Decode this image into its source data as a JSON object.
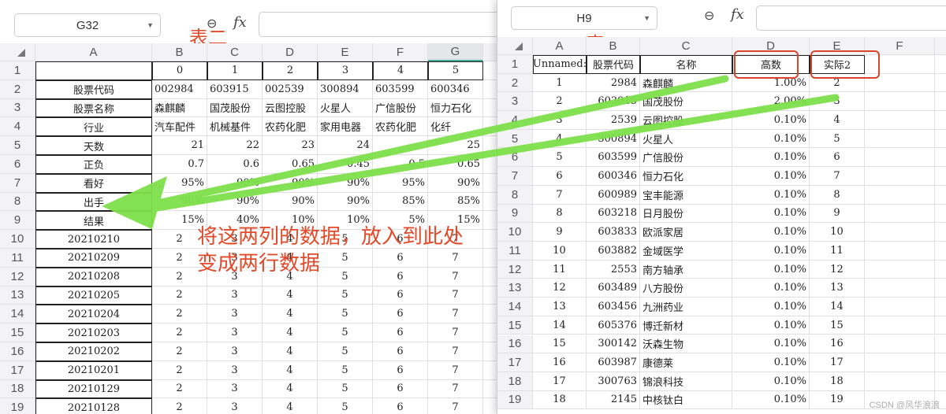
{
  "left": {
    "name_box": "G32",
    "label": "表二",
    "columns": [
      "A",
      "B",
      "C",
      "D",
      "E",
      "F",
      "G"
    ],
    "selected_column": "G",
    "rows": [
      [
        "",
        "0",
        "1",
        "2",
        "3",
        "4",
        "5"
      ],
      [
        "股票代码",
        "002984",
        "603915",
        "002539",
        "300894",
        "603599",
        "600346"
      ],
      [
        "股票名称",
        "森麒麟",
        "国茂股份",
        "云图控股",
        "火星人",
        "广信股份",
        "恒力石化"
      ],
      [
        "行业",
        "汽车配件",
        "机械基件",
        "农药化肥",
        "家用电器",
        "农药化肥",
        "化纤"
      ],
      [
        "天数",
        "21",
        "22",
        "23",
        "24",
        "",
        "25"
      ],
      [
        "正负",
        "0.7",
        "0.6",
        "0.65",
        "0.45",
        "0.5",
        "0.65"
      ],
      [
        "看好",
        "95%",
        "90%",
        "90%",
        "90%",
        "95%",
        "90%"
      ],
      [
        "出手",
        "90%",
        "90%",
        "90%",
        "90%",
        "85%",
        "85%"
      ],
      [
        "结果",
        "15%",
        "40%",
        "10%",
        "10%",
        "5%",
        "15%"
      ],
      [
        "20210210",
        "2",
        "3",
        "4",
        "5",
        "6",
        "7"
      ],
      [
        "20210209",
        "2",
        "3",
        "4",
        "5",
        "6",
        "7"
      ],
      [
        "20210208",
        "2",
        "3",
        "4",
        "5",
        "6",
        "7"
      ],
      [
        "20210205",
        "2",
        "3",
        "4",
        "5",
        "6",
        "7"
      ],
      [
        "20210204",
        "2",
        "3",
        "4",
        "5",
        "6",
        "7"
      ],
      [
        "20210203",
        "2",
        "3",
        "4",
        "5",
        "6",
        "7"
      ],
      [
        "20210202",
        "2",
        "3",
        "4",
        "5",
        "6",
        "7"
      ],
      [
        "20210201",
        "2",
        "3",
        "4",
        "5",
        "6",
        "7"
      ],
      [
        "20210129",
        "2",
        "3",
        "4",
        "5",
        "6",
        "7"
      ],
      [
        "20210128",
        "2",
        "3",
        "4",
        "5",
        "6",
        "7"
      ]
    ]
  },
  "right": {
    "name_box": "H9",
    "label": "表一",
    "columns": [
      "A",
      "B",
      "C",
      "D",
      "E",
      "F"
    ],
    "rows": [
      [
        "Unnamed:",
        "股票代码",
        "名称",
        "高数",
        "实际2",
        ""
      ],
      [
        "1",
        "2984",
        "森麒麟",
        "1.00%",
        "2",
        ""
      ],
      [
        "2",
        "603915",
        "国茂股份",
        "2.00%",
        "3",
        ""
      ],
      [
        "3",
        "2539",
        "云图控股",
        "0.10%",
        "4",
        ""
      ],
      [
        "4",
        "300894",
        "火星人",
        "0.10%",
        "5",
        ""
      ],
      [
        "5",
        "603599",
        "广信股份",
        "0.10%",
        "6",
        ""
      ],
      [
        "6",
        "600346",
        "恒力石化",
        "0.10%",
        "7",
        ""
      ],
      [
        "7",
        "600989",
        "宝丰能源",
        "0.10%",
        "8",
        ""
      ],
      [
        "8",
        "603218",
        "日月股份",
        "0.10%",
        "9",
        ""
      ],
      [
        "9",
        "603833",
        "欧派家居",
        "0.10%",
        "10",
        ""
      ],
      [
        "10",
        "603882",
        "金域医学",
        "0.10%",
        "11",
        ""
      ],
      [
        "11",
        "2553",
        "南方轴承",
        "0.10%",
        "12",
        ""
      ],
      [
        "12",
        "603489",
        "八方股份",
        "0.10%",
        "13",
        ""
      ],
      [
        "13",
        "603456",
        "九洲药业",
        "0.10%",
        "14",
        ""
      ],
      [
        "14",
        "605376",
        "博迁新材",
        "0.10%",
        "15",
        ""
      ],
      [
        "15",
        "300142",
        "沃森生物",
        "0.10%",
        "16",
        ""
      ],
      [
        "16",
        "603987",
        "康德莱",
        "0.10%",
        "17",
        ""
      ],
      [
        "17",
        "300763",
        "锦浪科技",
        "0.10%",
        "18",
        ""
      ],
      [
        "18",
        "2145",
        "中核钛白",
        "0.10%",
        "19",
        ""
      ]
    ]
  },
  "fx_label": "fx",
  "annotation": [
    "将这两列的数据，放入到此处",
    "变成两行数据"
  ],
  "watermark": "CSDN @风华浪浪",
  "colors": {
    "arrow": "#7ee04a",
    "annotation": "#e24a2a"
  }
}
